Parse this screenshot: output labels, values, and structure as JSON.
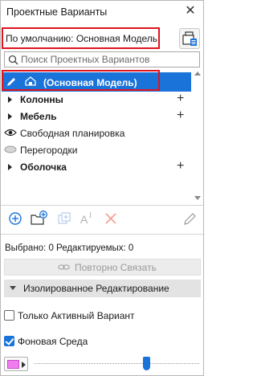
{
  "window": {
    "title": "Проектные Варианты"
  },
  "default_variant": "По умолчанию: Основная Модель",
  "search": {
    "placeholder": "Поиск Проектных Вариантов",
    "value": ""
  },
  "tree": [
    {
      "label": "(Основная Модель)",
      "selected": true
    },
    {
      "label": "Колонны",
      "expandable": true,
      "addable": true
    },
    {
      "label": "Мебель",
      "expandable": true,
      "addable": true
    },
    {
      "label": "Свободная планировка",
      "visibility": "visible"
    },
    {
      "label": "Перегородки",
      "visibility": "hidden"
    },
    {
      "label": "Оболочка",
      "expandable": true,
      "addable": true
    }
  ],
  "toolbar": {
    "icons": [
      "add-variant-icon",
      "new-folder-icon",
      "duplicate-icon",
      "rename-icon",
      "delete-icon",
      "edit-pencil-icon"
    ]
  },
  "status": "Выбрано: 0 Редактируемых: 0",
  "relink_button": "Повторно Связать",
  "isolated_section": "Изолированное Редактирование",
  "only_active": {
    "label": "Только Активный Вариант",
    "checked": false
  },
  "background": {
    "label": "Фоновая Среда",
    "checked": true,
    "color": "#f07cf0",
    "opacity_fraction": 0.68
  },
  "colors": {
    "accent": "#1a73d9",
    "highlight_frame": "#e0141e",
    "delete_red": "#e5553a"
  }
}
